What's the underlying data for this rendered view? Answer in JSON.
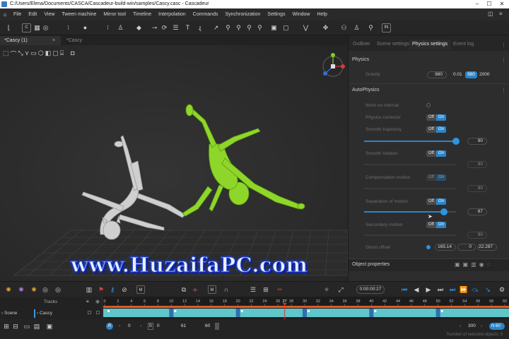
{
  "window": {
    "title": "C:/Users/Elena/Documents/CASCA/Cascadeur-build-win/samples/Cascy.casc - Cascadeur"
  },
  "menu": [
    "File",
    "Edit",
    "View",
    "Tween machine",
    "Mirror tool",
    "Timeline",
    "Interpolation",
    "Commands",
    "Synchronization",
    "Settings",
    "Window",
    "Help"
  ],
  "toolbar": {
    "c_label": "C",
    "in_label": "IN"
  },
  "tabs": [
    {
      "label": "*Cascy (1)",
      "active": true
    },
    {
      "label": "*Cascy",
      "active": false
    }
  ],
  "watermark": "www.HuzaifaPC.com",
  "right_panel": {
    "tabs": [
      "Outliner",
      "Scene settings",
      "Physics settings",
      "Event log"
    ],
    "active_tab": "Physics settings",
    "physics_header": "Physics",
    "gravity": {
      "label": "Gravity",
      "value": "980",
      "presets": [
        "0.01",
        "980",
        "2000"
      ]
    },
    "autophysics_header": "AutoPhysics",
    "work_on_interval": "Work on interval",
    "physics_corrector": "Physics corrector",
    "smooth_trajectory": {
      "label": "Smooth trajectory",
      "value": "90",
      "level": 1.0
    },
    "smooth_rotation": {
      "label": "Smooth rotation",
      "value": "90"
    },
    "compensation_motion": {
      "label": "Compensation motion",
      "value": "90"
    },
    "separation_of_motion": {
      "label": "Separation of motion",
      "value": "87",
      "level": 0.87
    },
    "secondary_motion": {
      "label": "Secondary motion",
      "value": "90"
    },
    "ghost_offset": {
      "label": "Ghost offset",
      "values": [
        "165.14",
        "0",
        "22.287"
      ]
    },
    "toggle_off": "Off",
    "toggle_on": "On",
    "object_properties": "Object properties"
  },
  "timeline": {
    "time": "0:00:00:27",
    "tracks_label": "Tracks",
    "scene_label": "Scene",
    "cascy_label": "Cascy",
    "ticks": [
      "0",
      "2",
      "4",
      "6",
      "8",
      "10",
      "12",
      "14",
      "16",
      "18",
      "20",
      "22",
      "24",
      "26",
      "27",
      "28",
      "30",
      "32",
      "34",
      "36",
      "38",
      "40",
      "42",
      "44",
      "46",
      "48",
      "50",
      "52",
      "54",
      "56",
      "58",
      "60"
    ],
    "current_frame": 27,
    "total_frames": 60
  },
  "bottom": {
    "r_label": "R",
    "b_label": "B",
    "field1": "0",
    "field2": "0",
    "field3": "61",
    "field4": "60",
    "fps": "300",
    "n_label": "N",
    "n_value": "60",
    "status": "Number of selected objects: 0"
  },
  "colors": {
    "accent": "#2a85c8",
    "playhead": "#e0302a",
    "character_selected": "#8fd62a",
    "character_ghost": "#c8c8c8",
    "track_fill": "#5fc6c9"
  }
}
